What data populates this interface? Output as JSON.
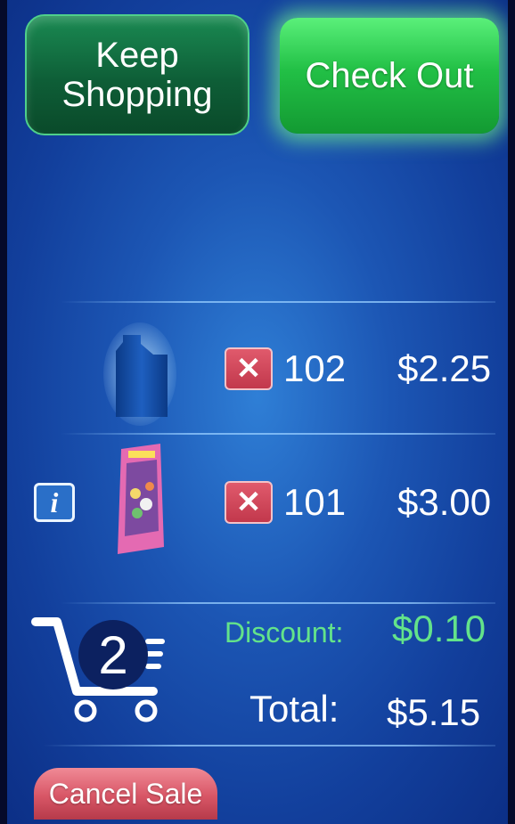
{
  "header": {
    "keep_shopping": [
      "Keep",
      "Shopping"
    ],
    "check_out": "Check Out"
  },
  "cart": {
    "items": [
      {
        "icon": "bottle-product-icon",
        "code": "102",
        "price": "$2.25",
        "remove": "✕"
      },
      {
        "icon": "snack-bag-product-icon",
        "code": "101",
        "price": "$3.00",
        "remove": "✕",
        "info": "i"
      }
    ],
    "item_count": "2"
  },
  "summary": {
    "discount_label": "Discount:",
    "discount_value": "$0.10",
    "total_label": "Total:",
    "total_value": "$5.15"
  },
  "footer": {
    "cancel_sale": "Cancel Sale"
  },
  "colors": {
    "background": "#1c56b4",
    "checkout": "#22c046",
    "keep_shopping": "#0e5e37",
    "remove": "#c2384c",
    "discount": "#63e38a",
    "cancel": "#d85666"
  }
}
